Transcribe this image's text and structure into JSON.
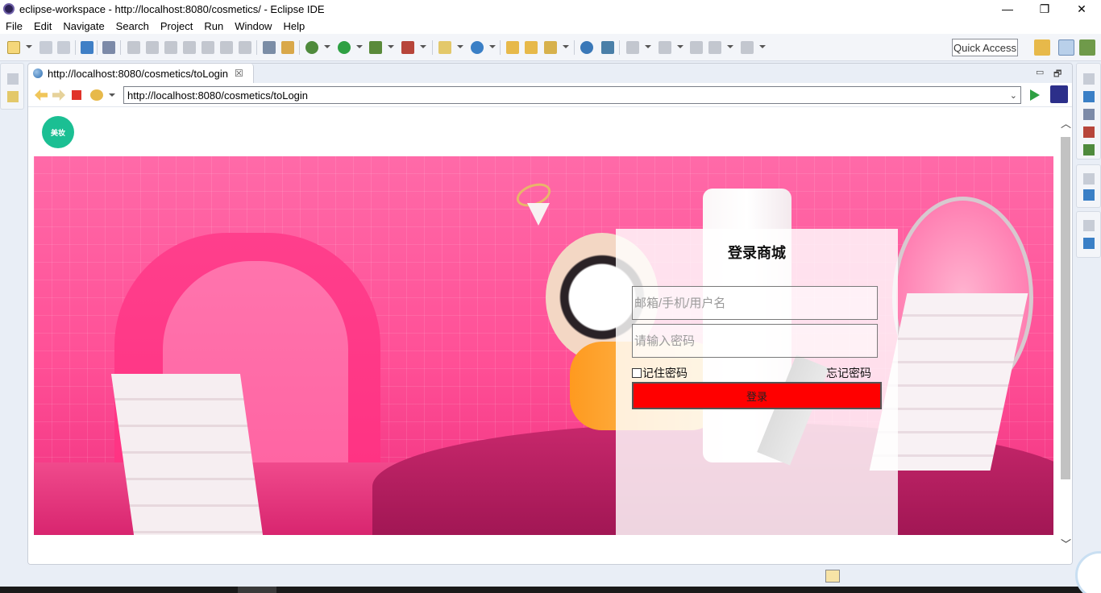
{
  "window": {
    "title": "eclipse-workspace - http://localhost:8080/cosmetics/ - Eclipse IDE",
    "controls": {
      "minimize": "—",
      "restore": "❐",
      "close": "✕"
    }
  },
  "menu": [
    "File",
    "Edit",
    "Navigate",
    "Search",
    "Project",
    "Run",
    "Window",
    "Help"
  ],
  "toolbar": {
    "quick_access": "Quick Access"
  },
  "editor": {
    "tab_label": "http://localhost:8080/cosmetics/toLogin",
    "tab_close": "☒",
    "view_minimize": "▭",
    "view_maximize": "🗗"
  },
  "browser": {
    "url": "http://localhost:8080/cosmetics/toLogin",
    "url_dropdown": "⌄"
  },
  "page": {
    "logo_text": "美妆",
    "login": {
      "title": "登录商城",
      "username_placeholder": "邮箱/手机/用户名",
      "password_placeholder": "请输入密码",
      "remember_label": "记住密码",
      "forgot_label": "忘记密码",
      "submit_label": "登录"
    }
  },
  "scrollbar": {
    "up": "︿",
    "down": "﹀"
  },
  "colors": {
    "login_button": "#ff0000",
    "logo": "#1bbf93",
    "banner_pink": "#ff4f96"
  }
}
